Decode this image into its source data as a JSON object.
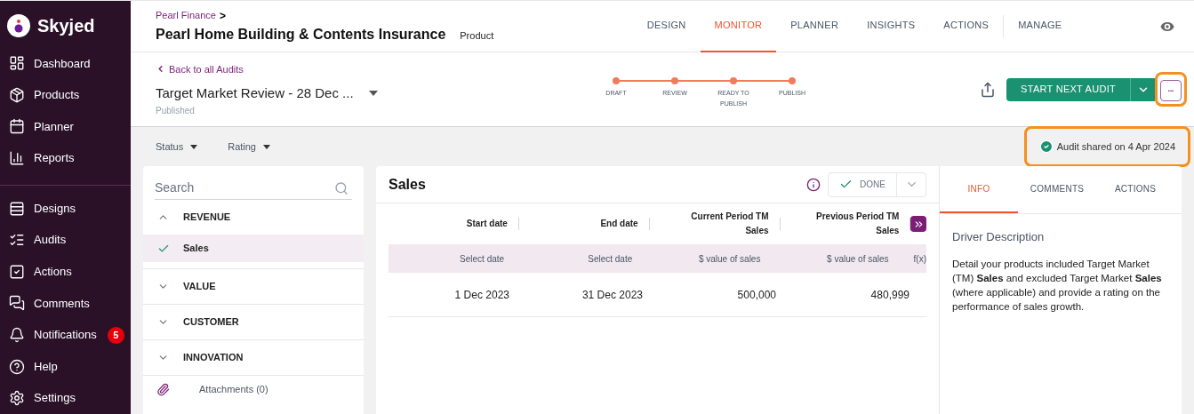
{
  "logo": {
    "name": "Skyjed"
  },
  "sidebar": {
    "sections": [
      [
        {
          "label": "Dashboard"
        },
        {
          "label": "Products"
        },
        {
          "label": "Planner"
        },
        {
          "label": "Reports"
        }
      ],
      [
        {
          "label": "Designs"
        },
        {
          "label": "Audits"
        },
        {
          "label": "Actions"
        },
        {
          "label": "Comments"
        },
        {
          "label": "Notifications",
          "badge": "5"
        },
        {
          "label": "Help"
        },
        {
          "label": "Settings"
        }
      ]
    ]
  },
  "header": {
    "breadcrumb": "Pearl Finance",
    "breadcrumb_icon": ">",
    "title": "Pearl Home Building & Contents Insurance",
    "subtitle": "Product",
    "tabs": [
      {
        "label": "DESIGN",
        "selected": false
      },
      {
        "label": "MONITOR",
        "selected": true
      },
      {
        "label": "PLANNER",
        "selected": false
      },
      {
        "label": "INSIGHTS",
        "selected": false
      },
      {
        "label": "ACTIONS",
        "selected": false
      },
      {
        "label": "MANAGE",
        "selected": false
      }
    ]
  },
  "audit": {
    "back_link": "Back to all Audits",
    "title": "Target Market Review - 28 Dec ...",
    "status": "Published",
    "steps": [
      {
        "label": "DRAFT",
        "done": true
      },
      {
        "label": "REVIEW",
        "done": true
      },
      {
        "label": "READY TO PUBLISH",
        "done": true
      },
      {
        "label": "PUBLISH",
        "done": true
      }
    ],
    "primary_button": "START NEXT AUDIT",
    "more_button": "•••",
    "highlighted": true
  },
  "filters": [
    {
      "label": "Status"
    },
    {
      "label": "Rating"
    }
  ],
  "shared_status": {
    "text": "Audit shared on 4 Apr 2024",
    "highlighted": true
  },
  "drivers": {
    "search_placeholder": "Search",
    "categories": [
      {
        "label": "REVENUE",
        "expanded": true,
        "children": [
          {
            "label": "Sales",
            "checked": true,
            "selected": true
          }
        ]
      },
      {
        "label": "VALUE",
        "expanded": false
      },
      {
        "label": "CUSTOMER",
        "expanded": false
      },
      {
        "label": "INNOVATION",
        "expanded": false
      }
    ],
    "attachments": "Attachments (0)"
  },
  "sales": {
    "title": "Sales",
    "done_button": "DONE",
    "done_disabled": true,
    "columns": [
      "Start date",
      "End date",
      "Current Period TM Sales",
      "Previous Period TM Sales"
    ],
    "hints": [
      "Select date",
      "Select date",
      "$ value of sales",
      "$ value of sales",
      "f(x)"
    ],
    "rows": [
      [
        "1 Dec 2023",
        "31 Dec 2023",
        "500,000",
        "480,999"
      ]
    ]
  },
  "info_panel": {
    "tabs": [
      {
        "label": "INFO",
        "selected": true
      },
      {
        "label": "COMMENTS",
        "selected": false
      },
      {
        "label": "ACTIONS",
        "selected": false
      }
    ],
    "heading": "Driver Description",
    "text": "Detail your products included Target Market (TM) **Sales** and excluded Target Market **Sales** (where applicable) and provide a rating on the performance of sales growth."
  }
}
